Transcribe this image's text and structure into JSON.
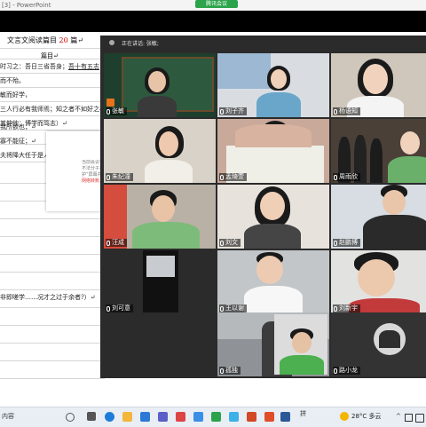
{
  "app": {
    "ppt_title": "[3] - PowerPoint",
    "meeting_pill": "腾讯会议"
  },
  "document": {
    "title_prefix": "文言文阅读篇目",
    "title_num": "20",
    "title_suffix": "篇↵",
    "subtitle": "篇目↵",
    "lines": [
      {
        "plain": "时习之：吾日三省吾身；",
        "under": "吾十有五志"
      },
      {
        "plain": "而不殆。",
        "under": ""
      },
      {
        "plain": "敏而好学，",
        "under": ""
      },
      {
        "plain": "三人行必有我师焉；知之者不如好之者；不义",
        "under": ""
      },
      {
        "plain": "其伸他；博学而笃志）↵",
        "under": ""
      },
      {
        "plain": "",
        "under": ""
      },
      {
        "plain": "我所欲也；↵",
        "under": ""
      },
      {
        "plain": "寡不能征；↵",
        "under": ""
      },
      {
        "plain": "夫将降大任于是人也↵",
        "under": ""
      }
    ],
    "notice_lines": [
      "当前会议存在",
      "不法分子以会",
      "护”屏幕共享",
      "网络转账。谨"
    ],
    "notice_red": "网络转账。谨",
    "bottom_line": "非即嗟学……况才之过于余者?）↵",
    "taskbar_label": "内容"
  },
  "meeting": {
    "speaking_label": "正在讲话: 张敏;",
    "participants": [
      {
        "name": "张敏",
        "muted": true,
        "speaking": true
      },
      {
        "name": "刘子齐",
        "muted": false,
        "speaking": false
      },
      {
        "name": "杨语知",
        "muted": false,
        "speaking": false
      },
      {
        "name": "朱纪潼",
        "muted": false,
        "speaking": false
      },
      {
        "name": "孟琦萱",
        "muted": false,
        "speaking": false
      },
      {
        "name": "周雨欣",
        "muted": false,
        "speaking": false
      },
      {
        "name": "汪成",
        "muted": false,
        "speaking": false
      },
      {
        "name": "刘文",
        "muted": false,
        "speaking": false
      },
      {
        "name": "赵鹏博",
        "muted": false,
        "speaking": false
      },
      {
        "name": "刘可意",
        "muted": false,
        "speaking": false
      },
      {
        "name": "王以谢",
        "muted": false,
        "speaking": false
      },
      {
        "name": "刘新宇",
        "muted": false,
        "speaking": false
      },
      {
        "name": "孤独",
        "muted": false,
        "speaking": false
      },
      {
        "name": "路小龙",
        "muted": false,
        "speaking": false
      }
    ]
  },
  "taskbar": {
    "search_icon": "search-icon",
    "weather": "28°C 多云",
    "lang": "拼",
    "colors": {
      "edge": "#1f7bd8",
      "teams": "#5b5fc7",
      "word": "#2b5797",
      "ppt": "#d24726",
      "green": "#2ba34a"
    }
  }
}
